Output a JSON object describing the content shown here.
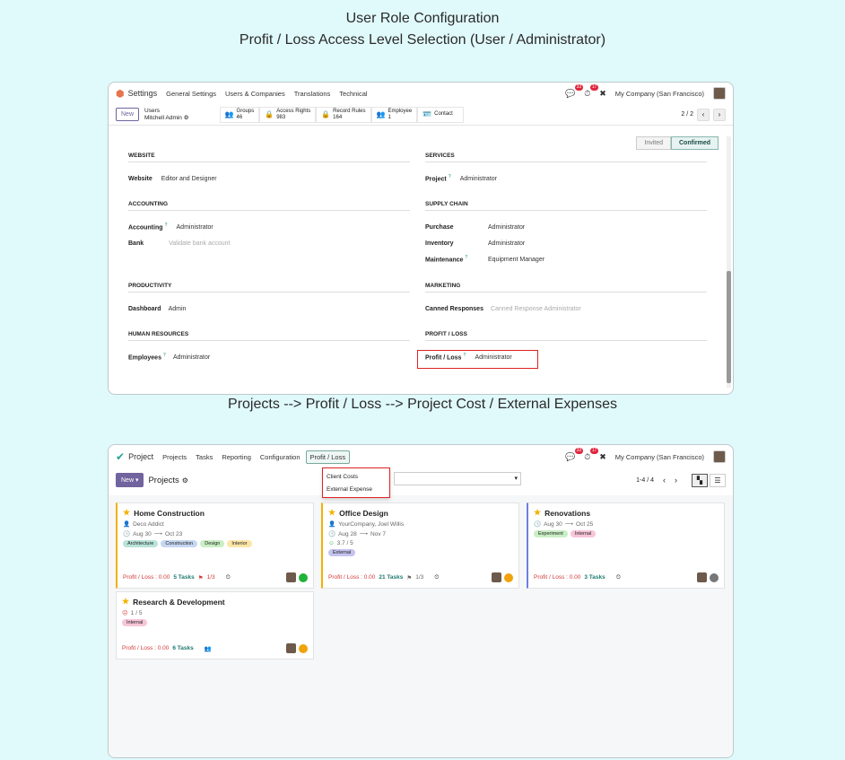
{
  "captions": {
    "title": "User Role Configuration",
    "subtitle": "Profit / Loss Access Level Selection (User / Administrator)",
    "flow": "Projects --> Profit / Loss --> Project Cost / External Expenses"
  },
  "settings": {
    "app_name": "Settings",
    "menus": [
      "General Settings",
      "Users & Companies",
      "Translations",
      "Technical"
    ],
    "chat_badge": "33",
    "activity_badge": "17",
    "company": "My Company (San Francisco)",
    "new_label": "New",
    "crumb_parent": "Users",
    "crumb_current": "Mitchell Admin",
    "gear": "⚙",
    "smart_buttons": [
      {
        "label": "Groups",
        "value": "46"
      },
      {
        "label": "Access Rights",
        "value": "983"
      },
      {
        "label": "Record Rules",
        "value": "164"
      },
      {
        "label": "Employee",
        "value": "1"
      },
      {
        "label": "Contact",
        "value": ""
      }
    ],
    "pager": "2 / 2",
    "status_invited": "Invited",
    "status_confirmed": "Confirmed",
    "sections": {
      "website": {
        "title": "WEBSITE",
        "rows": [
          {
            "label": "Website",
            "value": "Editor and Designer"
          }
        ]
      },
      "services": {
        "title": "SERVICES",
        "rows": [
          {
            "label": "Project",
            "value": "Administrator"
          }
        ]
      },
      "accounting": {
        "title": "ACCOUNTING",
        "rows": [
          {
            "label": "Accounting",
            "value": "Administrator"
          },
          {
            "label": "Bank",
            "value": "Validate bank account"
          }
        ]
      },
      "supply": {
        "title": "SUPPLY CHAIN",
        "rows": [
          {
            "label": "Purchase",
            "value": "Administrator"
          },
          {
            "label": "Inventory",
            "value": "Administrator"
          },
          {
            "label": "Maintenance",
            "value": "Equipment Manager"
          }
        ]
      },
      "productivity": {
        "title": "PRODUCTIVITY",
        "rows": [
          {
            "label": "Dashboard",
            "value": "Admin"
          }
        ]
      },
      "marketing": {
        "title": "MARKETING",
        "rows": [
          {
            "label": "Canned Responses",
            "value": "Canned Response Administrator"
          }
        ]
      },
      "hr": {
        "title": "HUMAN RESOURCES",
        "rows": [
          {
            "label": "Employees",
            "value": "Administrator"
          }
        ]
      },
      "profit": {
        "title": "PROFIT / LOSS",
        "rows": [
          {
            "label": "Profit / Loss",
            "value": "Administrator"
          }
        ]
      }
    }
  },
  "project": {
    "app_name": "Project",
    "menus": [
      "Projects",
      "Tasks",
      "Reporting",
      "Configuration"
    ],
    "active_menu": "Profit / Loss",
    "dropdown": [
      "Client Costs",
      "External Expense"
    ],
    "chat_badge": "33",
    "activity_badge": "17",
    "company": "My Company (San Francisco)",
    "new_label": "New ▾",
    "title": "Projects",
    "gear": "⚙",
    "pager": "1-4 / 4",
    "cards": [
      {
        "name": "Home Construction",
        "customer": "Deco Addict",
        "date_from": "Aug 30",
        "date_to": "Oct 23",
        "rating": "",
        "tags": [
          "Architecture",
          "Construction",
          "Design",
          "Interior"
        ],
        "pl": "Profit / Loss : 0.00",
        "tasks": "5 Tasks",
        "milestone": "1/3"
      },
      {
        "name": "Office Design",
        "customer": "YourCompany, Joel Willis",
        "date_from": "Aug 28",
        "date_to": "Nov 7",
        "rating": "3.7 / 5",
        "tags": [
          "External"
        ],
        "pl": "Profit / Loss : 0.00",
        "tasks": "21 Tasks",
        "milestone": "1/3"
      },
      {
        "name": "Renovations",
        "customer": "",
        "date_from": "Aug 30",
        "date_to": "Oct 25",
        "rating": "",
        "tags": [
          "Experiment",
          "Internal"
        ],
        "pl": "Profit / Loss : 0.00",
        "tasks": "3 Tasks",
        "milestone": ""
      },
      {
        "name": "Research & Development",
        "customer": "",
        "date_from": "",
        "date_to": "",
        "rating": "1 / 5",
        "tags": [
          "Internal"
        ],
        "pl": "Profit / Loss : 0.00",
        "tasks": "6 Tasks",
        "milestone": ""
      }
    ]
  },
  "colors": {
    "tag_architecture": "#b8e3d9",
    "tag_construction": "#c6d7f2",
    "tag_design": "#c9efc4",
    "tag_interior": "#fbe6a8",
    "tag_external": "#c5c3ef",
    "tag_experiment": "#c9efc4",
    "tag_internal": "#f7c5d8",
    "status_green": "#21b33a",
    "status_orange": "#f0a30a",
    "status_grey": "#777777"
  }
}
